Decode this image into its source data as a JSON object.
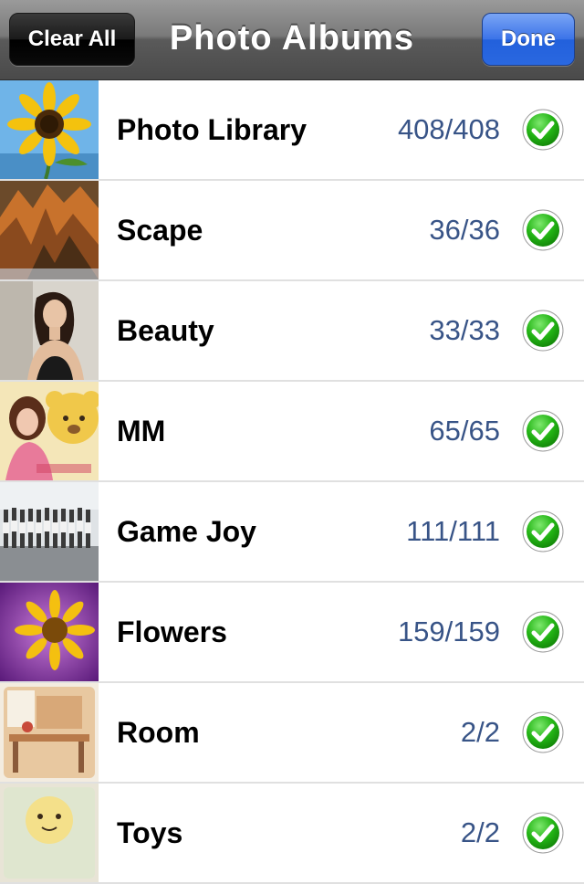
{
  "navbar": {
    "title": "Photo Albums",
    "clear_label": "Clear All",
    "done_label": "Done"
  },
  "albums": [
    {
      "name": "Photo Library",
      "count": "408/408",
      "selected": true,
      "thumb": "sunflower"
    },
    {
      "name": "Scape",
      "count": "36/36",
      "selected": true,
      "thumb": "mountain"
    },
    {
      "name": "Beauty",
      "count": "33/33",
      "selected": true,
      "thumb": "portrait"
    },
    {
      "name": "MM",
      "count": "65/65",
      "selected": true,
      "thumb": "bear"
    },
    {
      "name": "Game Joy",
      "count": "111/111",
      "selected": true,
      "thumb": "group"
    },
    {
      "name": "Flowers",
      "count": "159/159",
      "selected": true,
      "thumb": "flower-purple"
    },
    {
      "name": "Room",
      "count": "2/2",
      "selected": true,
      "thumb": "room"
    },
    {
      "name": "Toys",
      "count": "2/2",
      "selected": true,
      "thumb": "toy"
    }
  ],
  "colors": {
    "count_text": "#385487",
    "check_green": "#22b414",
    "done_blue": "#2a68e0"
  }
}
